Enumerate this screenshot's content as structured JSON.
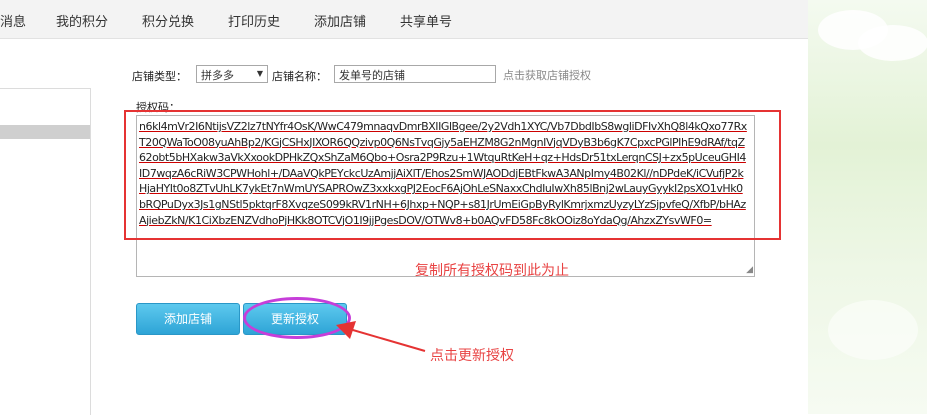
{
  "nav": {
    "items": [
      "消息",
      "我的积分",
      "积分兑换",
      "打印历史",
      "添加店铺",
      "共享单号"
    ]
  },
  "form": {
    "shop_type_label": "店铺类型：",
    "shop_type_value": "拼多多",
    "shop_name_label": "店铺名称：",
    "shop_name_value": "发单号的店铺",
    "get_auth_link": "点击获取店铺授权",
    "auth_code_label": "授权码：",
    "auth_code_value": "n6kl4mVr2I6NtijsVZ2lz7tNYfr4OsK/WwC479mnaqvDmrBXIIGlBgee/2y2Vdh1XYC/Vb7DbdIbS8wgliDFIvXhQ8l4kQxo77RxT20QWaToO08yuAhBp2/KGjCSHxJIXOR6QQzivp0Q6NsTvqGjy5aEHZM8G2nMgnIVjqVDyB3b6gK7CpxcPGlPIhE9dRAf/tqZ62obt5bHXakw3aVkXxookDPHkZQxShZaM6Qbo+Osra2P9Rzu+1WtquRtKeH+qz+HdsDr51txLerqnCSJ+zx5pUceuGHI4ID7wqzA6cRiW3CPWHohl+/DAaVQkPEYckcUzAmjjAiXlT/Ehos2SmWJAODdjEBtFkwA3ANpImy4B02Kl//nDPdeK/iCVufjP2kHjaHYIt0o8ZTvUhLK7ykEt7nWmUYSAPROwZ3xxkxgPJ2EocF6AjOhLeSNaxxChdIuIwXh85lBnj2wLauyGyykI2psXO1vHk0bRQPuDyx3Js1gNStl5pktqrF8XvqzeS099kRV1rNH+6Jhxp+NQP+s81JrUmEiGpByRylKmrjxmzUyzyLYzSjpvfeQ/XfbP/bHAzAjiebZkN/K1CiXbzENZVdhoPjHKk8OTCVjO1I9jjPgesDOV/OTWv8+b0AQvFD58Fc8kOOiz8oYdaQg/AhzxZYsvWF0="
  },
  "annotations": {
    "copy_note": "复制所有授权码到此为止",
    "click_note": "点击更新授权"
  },
  "buttons": {
    "add_shop": "添加店铺",
    "update_auth": "更新授权"
  },
  "colors": {
    "annotation_red": "#e53333",
    "highlight_magenta": "#c63ed9",
    "button_blue": "#2ea4d6"
  }
}
